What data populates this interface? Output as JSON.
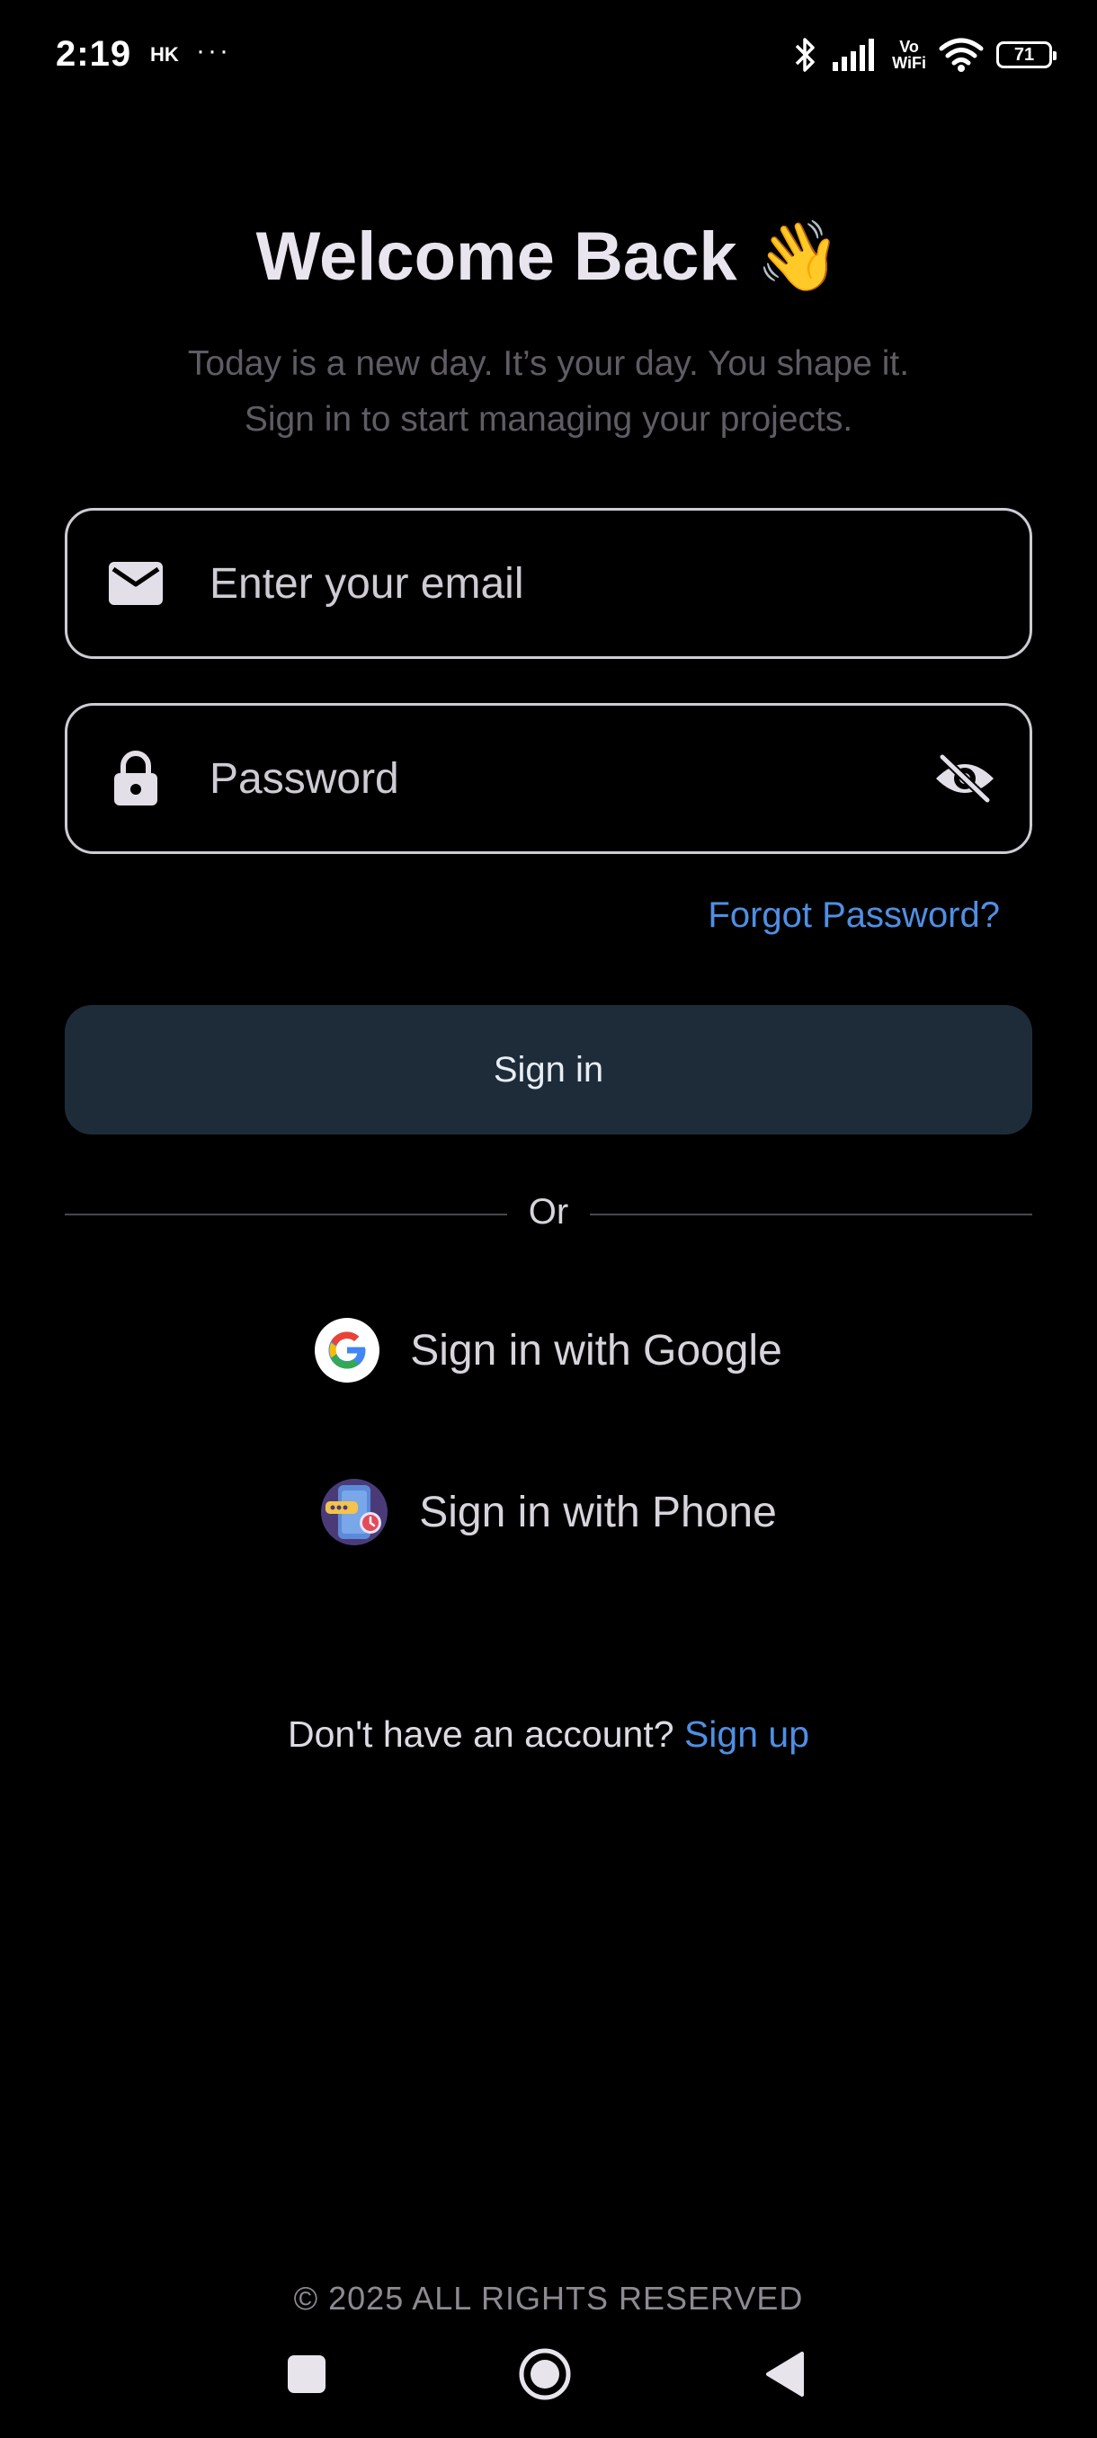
{
  "status_bar": {
    "time": "2:19",
    "carrier": "HK",
    "dots": "···",
    "vowifi_top": "Vo",
    "vowifi_bottom": "WiFi",
    "battery": "71"
  },
  "header": {
    "title": "Welcome Back 👋",
    "subtitle_line1": "Today is a new day. It’s your day. You shape it.",
    "subtitle_line2": "Sign in to start managing your projects."
  },
  "form": {
    "email_placeholder": "Enter your email",
    "password_placeholder": "Password",
    "forgot_label": "Forgot Password?",
    "signin_label": "Sign in"
  },
  "divider": {
    "label": "Or"
  },
  "social": {
    "google_label": "Sign in with Google",
    "phone_label": "Sign in with Phone"
  },
  "signup": {
    "prompt": "Don't have an account?",
    "link": "Sign up"
  },
  "footer": {
    "text": "© 2025 ALL RIGHTS RESERVED"
  },
  "colors": {
    "background": "#000000",
    "accent_link": "#4f8fe3",
    "button_bg": "#1e2c3a",
    "field_border": "#cfcbd3"
  }
}
